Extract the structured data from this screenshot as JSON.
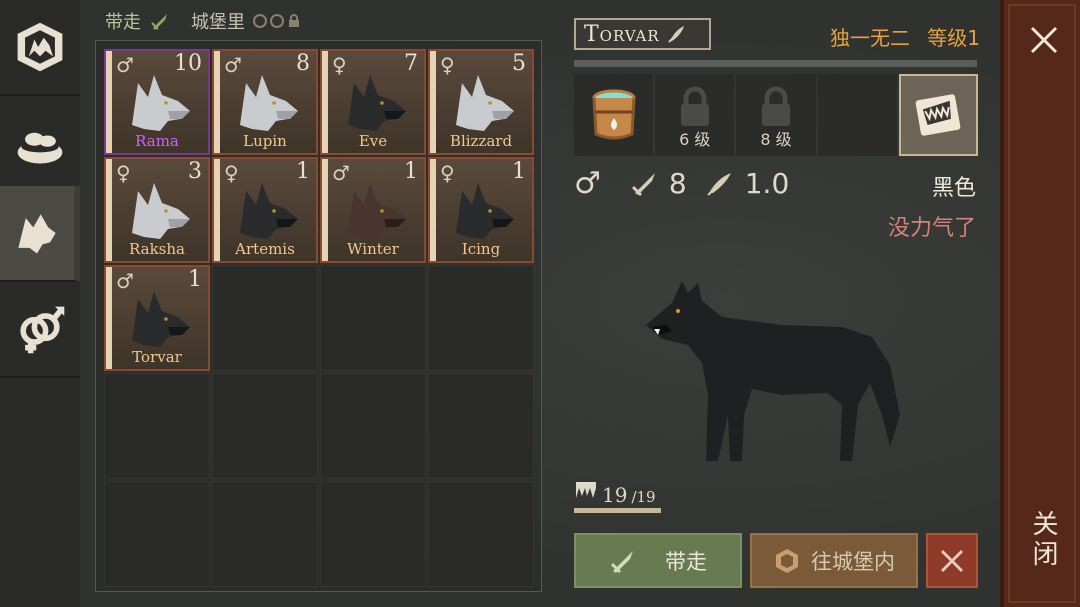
{
  "top_tabs": {
    "take_label": "带走",
    "castle_label": "城堡里"
  },
  "wolves": [
    {
      "name": "Rama",
      "level": "10",
      "gender": "♂",
      "fur": "gray",
      "name_color": "purple"
    },
    {
      "name": "Lupin",
      "level": "8",
      "gender": "♂",
      "fur": "gray",
      "name_color": "orange"
    },
    {
      "name": "Eve",
      "level": "7",
      "gender": "♀",
      "fur": "black",
      "name_color": "orange"
    },
    {
      "name": "Blizzard",
      "level": "5",
      "gender": "♀",
      "fur": "gray",
      "name_color": "orange"
    },
    {
      "name": "Raksha",
      "level": "3",
      "gender": "♀",
      "fur": "gray",
      "name_color": "orange"
    },
    {
      "name": "Artemis",
      "level": "1",
      "gender": "♀",
      "fur": "black",
      "name_color": "orange"
    },
    {
      "name": "Winter",
      "level": "1",
      "gender": "♂",
      "fur": "brown",
      "name_color": "orange"
    },
    {
      "name": "Icing",
      "level": "1",
      "gender": "♀",
      "fur": "black",
      "name_color": "orange"
    },
    {
      "name": "Torvar",
      "level": "1",
      "gender": "♂",
      "fur": "black",
      "name_color": "orange"
    }
  ],
  "detail": {
    "name": "Torvar",
    "rarity": "独一无二",
    "level_label": "等级1",
    "slot_lock_1": "6 级",
    "slot_lock_2": "8 级",
    "gender": "♂",
    "attack": "8",
    "speed": "1.0",
    "color_label": "黑色",
    "status": "没力气了",
    "hunger_current": "19",
    "hunger_max": "/19"
  },
  "buttons": {
    "take": "带走",
    "to_castle": "往城堡内"
  },
  "close_label": "关闭",
  "colors": {
    "accent_orange": "#e8a23a",
    "status_red": "#d8807a",
    "take_green": "#687a52",
    "castle_brown": "#7a5a38",
    "close_red": "#55281a"
  }
}
